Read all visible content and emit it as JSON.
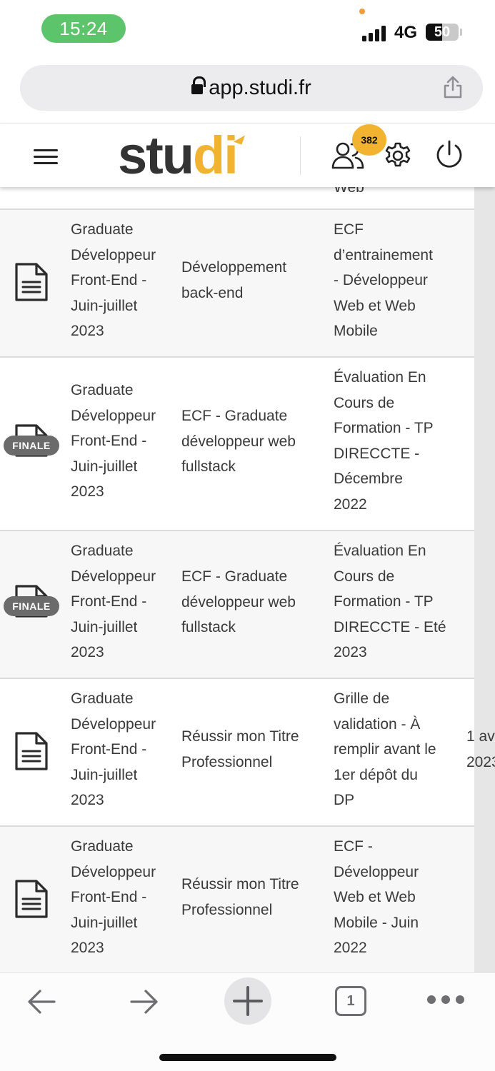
{
  "status_bar": {
    "time": "15:24",
    "network": "4G",
    "battery_percent": "50",
    "battery_level": 0.5
  },
  "browser": {
    "url": "app.studi.fr"
  },
  "header": {
    "logo_main": "stu",
    "logo_accent": "di",
    "notification_count": "382"
  },
  "colors": {
    "brand_accent": "#f2b430",
    "time_pill": "#5cc46a",
    "finale_badge": "#6b6b6b"
  },
  "table": {
    "partial_top_text": "Web",
    "rows": [
      {
        "icon": "document-icon",
        "finale": false,
        "program": [
          "Graduate",
          "Développeur",
          "Front-End -",
          "Juin-juillet",
          "2023"
        ],
        "module": [
          "Développement",
          "back-end"
        ],
        "title": [
          "ECF",
          "d’entrainement",
          "- Développeur",
          "Web et Web",
          "Mobile"
        ],
        "date": []
      },
      {
        "icon": "document-icon",
        "finale": true,
        "finale_label": "FINALE",
        "program": [
          "Graduate",
          "Développeur",
          "Front-End -",
          "Juin-juillet",
          "2023"
        ],
        "module": [
          "ECF - Graduate",
          "développeur web",
          "fullstack"
        ],
        "title": [
          "Évaluation En",
          "Cours de",
          "Formation - TP",
          "DIRECCTE -",
          "Décembre",
          "2022"
        ],
        "date": []
      },
      {
        "icon": "document-icon",
        "finale": true,
        "finale_label": "FINALE",
        "program": [
          "Graduate",
          "Développeur",
          "Front-End -",
          "Juin-juillet",
          "2023"
        ],
        "module": [
          "ECF - Graduate",
          "développeur web",
          "fullstack"
        ],
        "title": [
          "Évaluation En",
          "Cours de",
          "Formation - TP",
          "DIRECCTE - Eté",
          "2023"
        ],
        "date": []
      },
      {
        "icon": "document-icon",
        "finale": false,
        "program": [
          "Graduate",
          "Développeur",
          "Front-End -",
          "Juin-juillet",
          "2023"
        ],
        "module": [
          "Réussir mon Titre",
          "Professionnel"
        ],
        "title": [
          "Grille de",
          "validation - À",
          "remplir avant le",
          "1er dépôt du",
          "DP"
        ],
        "date": [
          "1 av",
          "2023"
        ]
      },
      {
        "icon": "document-icon",
        "finale": false,
        "program": [
          "Graduate",
          "Développeur",
          "Front-End -",
          "Juin-juillet",
          "2023"
        ],
        "module": [
          "Réussir mon Titre",
          "Professionnel"
        ],
        "title": [
          "ECF -",
          "Développeur",
          "Web et Web",
          "Mobile - Juin",
          "2022"
        ],
        "date": []
      }
    ]
  },
  "toolbar": {
    "tab_count": "1"
  }
}
